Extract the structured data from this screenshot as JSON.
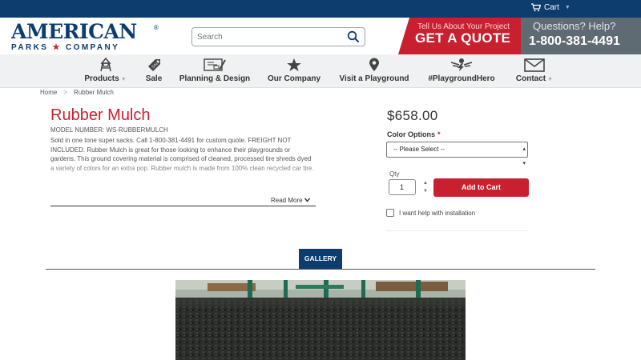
{
  "topbar": {
    "cart_label": "Cart"
  },
  "header": {
    "logo_line1": "AMERICAN",
    "logo_line2_a": "PARKS",
    "logo_line2_b": "COMPANY",
    "logo_reg": "®",
    "search_placeholder": "Search",
    "quote_line1": "Tell Us About Your Project",
    "quote_line2": "GET A QUOTE",
    "help_line1": "Questions? Help?",
    "help_phone": "1-800-381-4491"
  },
  "nav": {
    "items": [
      {
        "label": "Products",
        "icon": "playground-icon",
        "dropdown": true
      },
      {
        "label": "Sale",
        "icon": "sale-tag-icon",
        "dropdown": false
      },
      {
        "label": "Planning & Design",
        "icon": "blueprint-icon",
        "dropdown": false
      },
      {
        "label": "Our Company",
        "icon": "star-icon",
        "dropdown": false
      },
      {
        "label": "Visit a Playground",
        "icon": "map-pin-icon",
        "dropdown": false
      },
      {
        "label": "#PlaygroundHero",
        "icon": "hero-icon",
        "dropdown": false
      },
      {
        "label": "Contact",
        "icon": "envelope-icon",
        "dropdown": true
      }
    ]
  },
  "breadcrumb": {
    "home": "Home",
    "separator": ">",
    "current": "Rubber Mulch"
  },
  "product": {
    "title": "Rubber Mulch",
    "model": "MODEL NUMBER: WS-RUBBERMULCH",
    "description": "Sold in one tone super sacks. Call 1-800-381-4491 for custom quote. FREIGHT NOT INCLUDED. Rubber Mulch is great for those looking to enhance their playgrounds or gardens. This ground covering material is comprised of cleaned, processed tire shreds dyed a variety of colors for an extra pop. Rubber mulch is made from 100% clean recycled car tire.",
    "read_more": "Read More",
    "price": "$658.00",
    "color_options_label": "Color Options",
    "required_mark": "*",
    "color_select_value": "-- Please Select --",
    "qty_label": "Qty",
    "qty_value": "1",
    "add_to_cart": "Add to Cart",
    "install_help": "I want help with installation"
  },
  "gallery": {
    "tab_label": "GALLERY"
  },
  "colors": {
    "brand_blue": "#0d3c6e",
    "brand_red": "#c8202f",
    "phone_gray": "#5f6b73"
  }
}
